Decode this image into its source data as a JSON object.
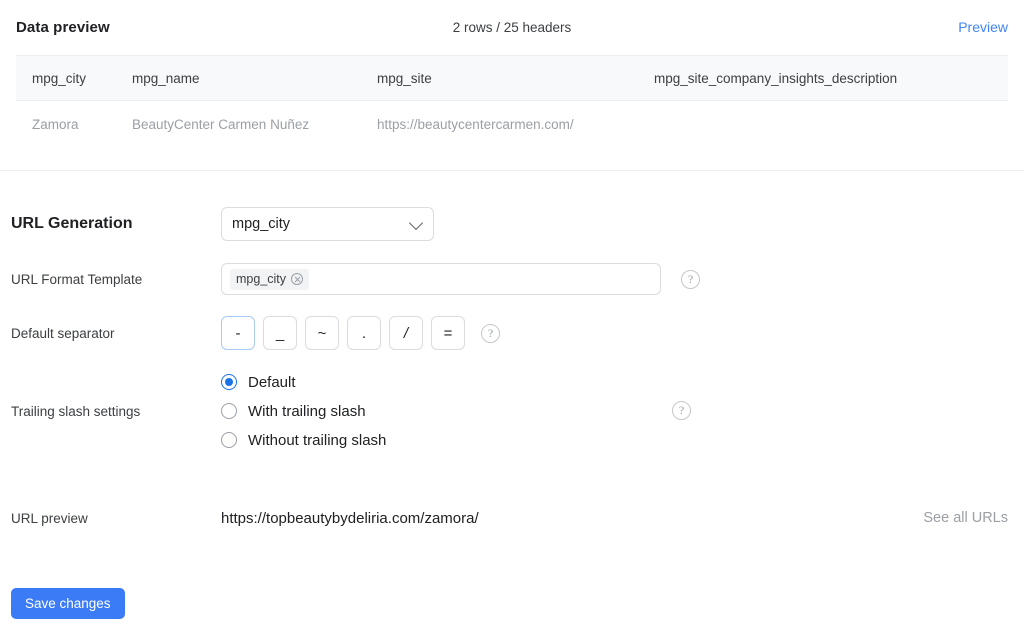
{
  "data_preview": {
    "title": "Data preview",
    "count_text": "2 rows / 25 headers",
    "preview_link": "Preview",
    "columns": [
      "mpg_city",
      "mpg_name",
      "mpg_site",
      "mpg_site_company_insights_description"
    ],
    "rows": [
      [
        "Zamora",
        "BeautyCenter Carmen Nuñez",
        "https://beautycentercarmen.com/",
        ""
      ]
    ]
  },
  "url_generation": {
    "section_label": "URL Generation",
    "select_value": "mpg_city",
    "template_label": "URL Format Template",
    "template_chip": "mpg_city",
    "separator_label": "Default separator",
    "separators": [
      "-",
      "_",
      "~",
      ".",
      "/",
      "="
    ],
    "selected_separator": "-",
    "trailing_label": "Trailing slash settings",
    "trailing_options": [
      "Default",
      "With trailing slash",
      "Without trailing slash"
    ],
    "selected_trailing": "Default",
    "preview_label": "URL preview",
    "preview_value": "https://topbeautybydeliria.com/zamora/",
    "see_all_label": "See all URLs",
    "help_glyph": "?"
  },
  "footer": {
    "save_label": "Save changes"
  },
  "colors": {
    "accent_blue": "#4285f4",
    "button_blue": "#3b7cf6",
    "radio_blue": "#1a73e8",
    "muted": "#9aa0a6"
  }
}
